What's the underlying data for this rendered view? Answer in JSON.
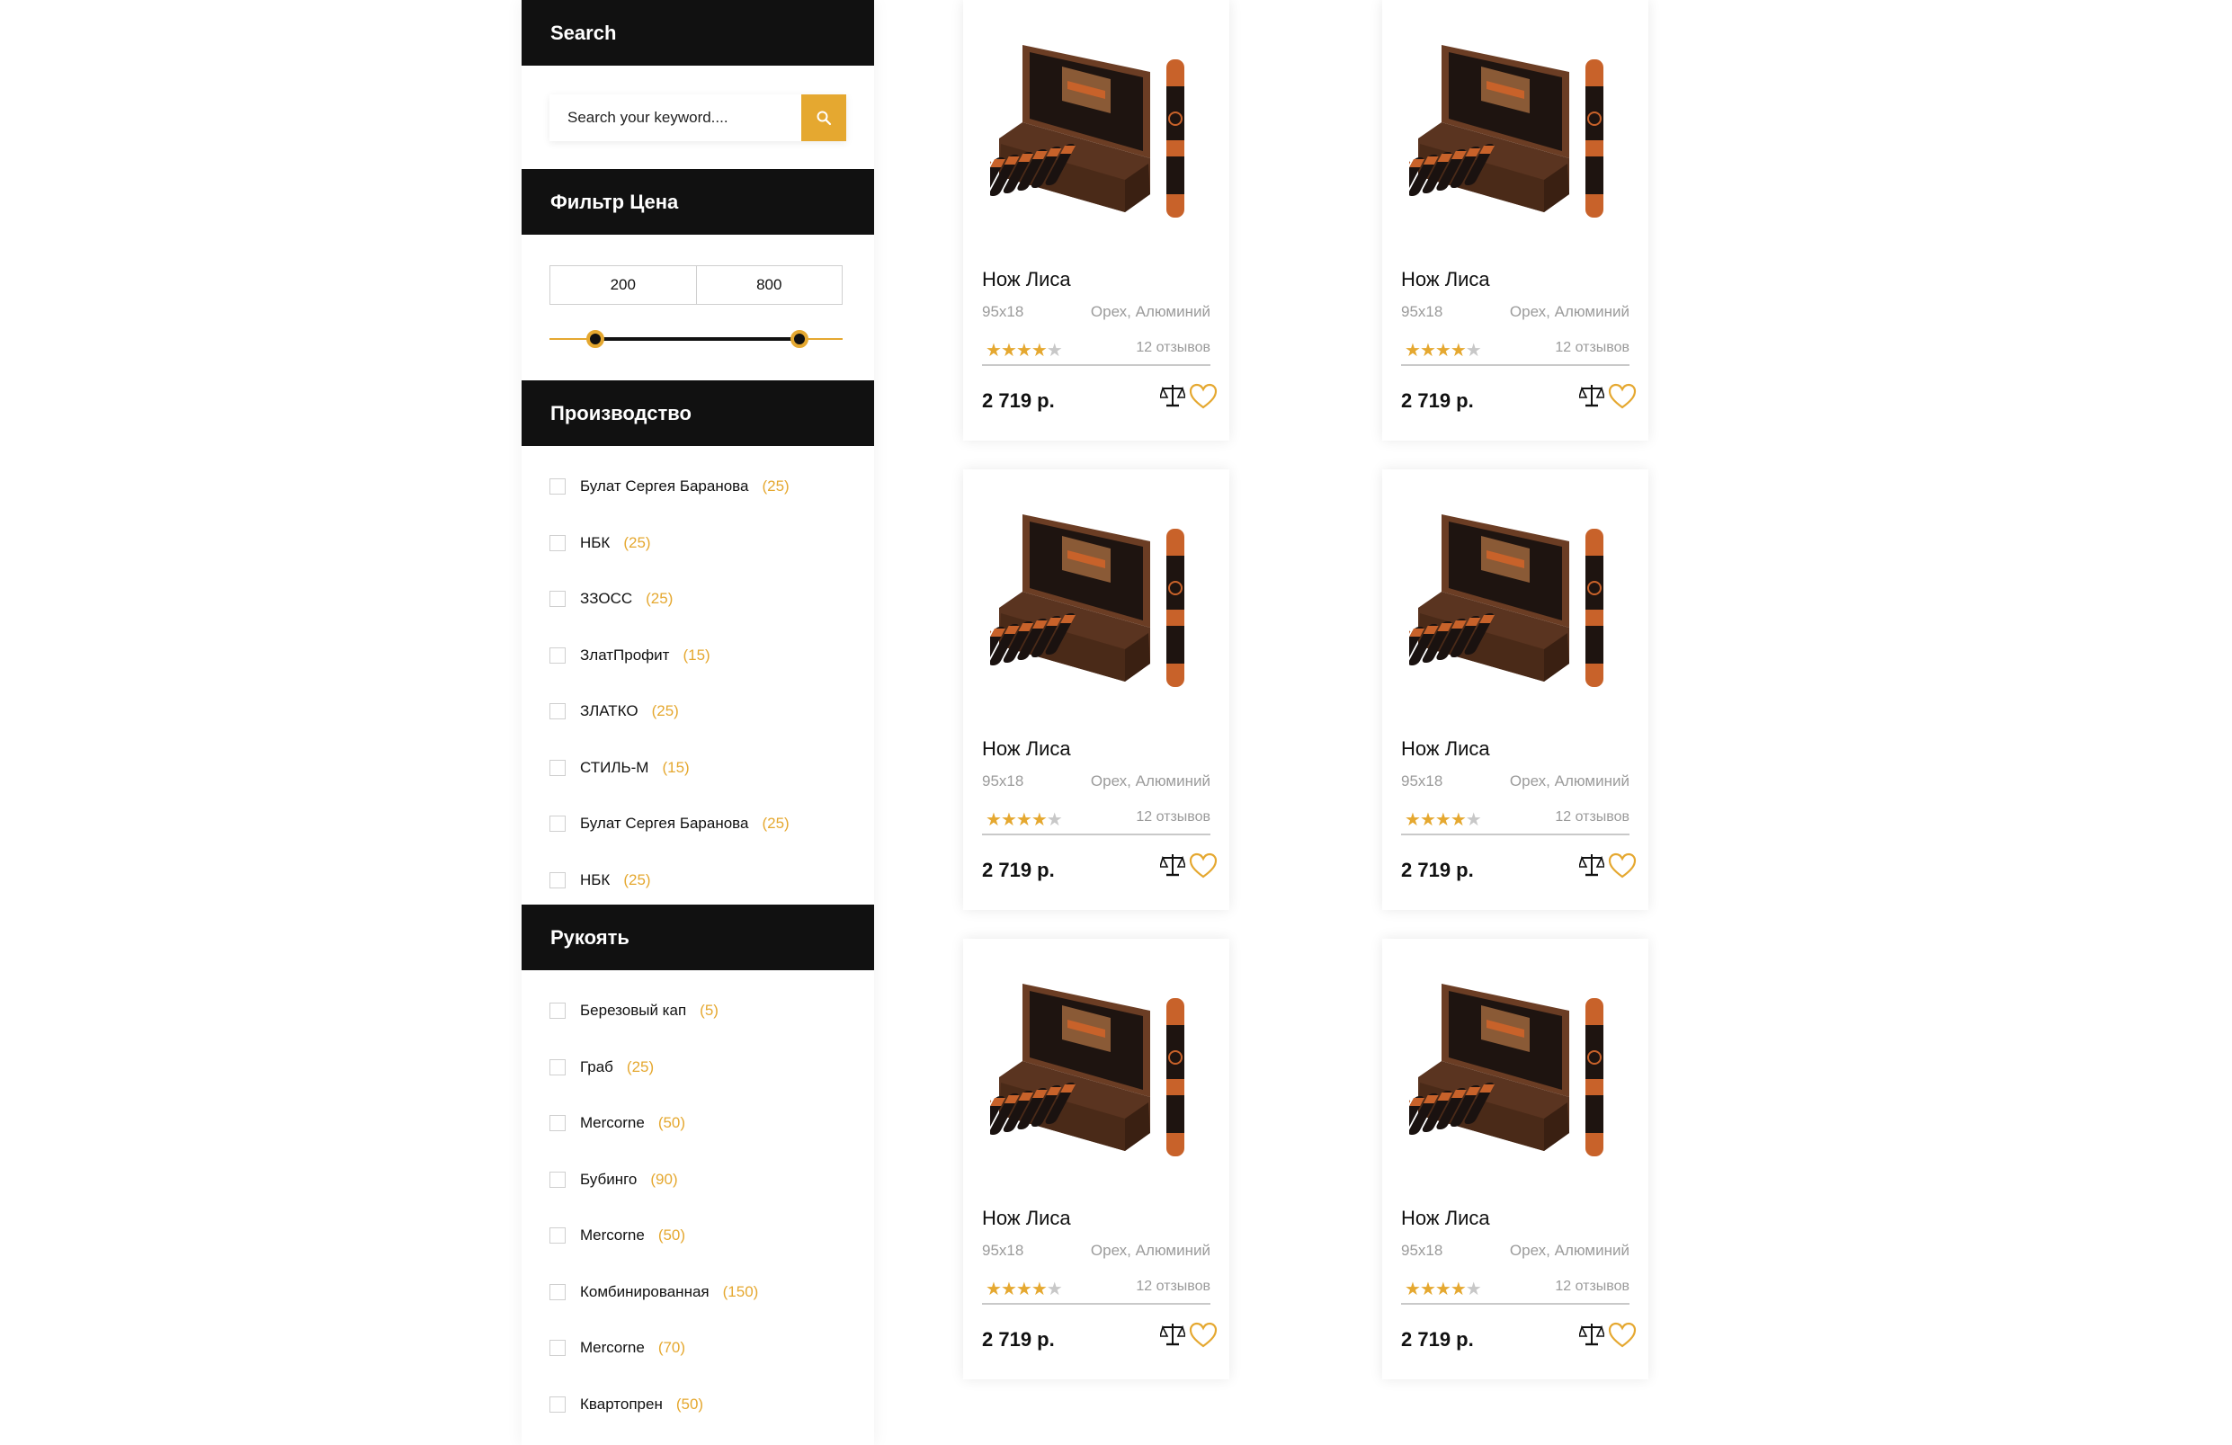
{
  "search": {
    "title": "Search",
    "placeholder": "Search your keyword...."
  },
  "price_filter": {
    "title": "Фильтр Цена",
    "min": "200",
    "max": "800"
  },
  "manufacturer": {
    "title": "Производство",
    "items": [
      {
        "label": "Булат Сергея Баранова",
        "count": "(25)"
      },
      {
        "label": "НБК",
        "count": "(25)"
      },
      {
        "label": "ЗЗОСС",
        "count": "(25)"
      },
      {
        "label": "ЗлатПрофит",
        "count": "(15)"
      },
      {
        "label": "ЗЛАТКО",
        "count": "(25)"
      },
      {
        "label": "СТИЛЬ-М",
        "count": "(15)"
      },
      {
        "label": "Булат Сергея Баранова",
        "count": "(25)"
      },
      {
        "label": "НБК",
        "count": "(25)"
      }
    ]
  },
  "handle": {
    "title": "Рукоять",
    "items": [
      {
        "label": "Березовый кап",
        "count": "(5)"
      },
      {
        "label": "Граб",
        "count": "(25)"
      },
      {
        "label": "Mercorne",
        "count": "(50)"
      },
      {
        "label": "Бубинго",
        "count": "(90)"
      },
      {
        "label": "Mercorne",
        "count": "(50)"
      },
      {
        "label": "Комбинированная",
        "count": "(150)"
      },
      {
        "label": "Mercorne",
        "count": "(70)"
      },
      {
        "label": "Квартопрен",
        "count": "(50)"
      }
    ]
  },
  "products": [
    {
      "name": "Нож Лиса",
      "size": "95x18",
      "material": "Орех, Алюминий",
      "rating": 3.5,
      "reviews": "12 отзывов",
      "price": "2 719 р."
    },
    {
      "name": "Нож Лиса",
      "size": "95x18",
      "material": "Орех, Алюминий",
      "rating": 3.5,
      "reviews": "12 отзывов",
      "price": "2 719 р."
    },
    {
      "name": "Нож Лиса",
      "size": "95x18",
      "material": "Орех, Алюминий",
      "rating": 3.5,
      "reviews": "12 отзывов",
      "price": "2 719 р."
    },
    {
      "name": "Нож Лиса",
      "size": "95x18",
      "material": "Орех, Алюминий",
      "rating": 3.5,
      "reviews": "12 отзывов",
      "price": "2 719 р."
    },
    {
      "name": "Нож Лиса",
      "size": "95x18",
      "material": "Орех, Алюминий",
      "rating": 3.5,
      "reviews": "12 отзывов",
      "price": "2 719 р."
    },
    {
      "name": "Нож Лиса",
      "size": "95x18",
      "material": "Орех, Алюминий",
      "rating": 3.5,
      "reviews": "12 отзывов",
      "price": "2 719 р."
    }
  ],
  "colors": {
    "accent": "#e5a830",
    "header_bg": "#111111",
    "muted_text": "#9b9b9b"
  },
  "icons": {
    "search": "search-icon",
    "compare": "scales-icon",
    "favorite": "heart-icon"
  }
}
